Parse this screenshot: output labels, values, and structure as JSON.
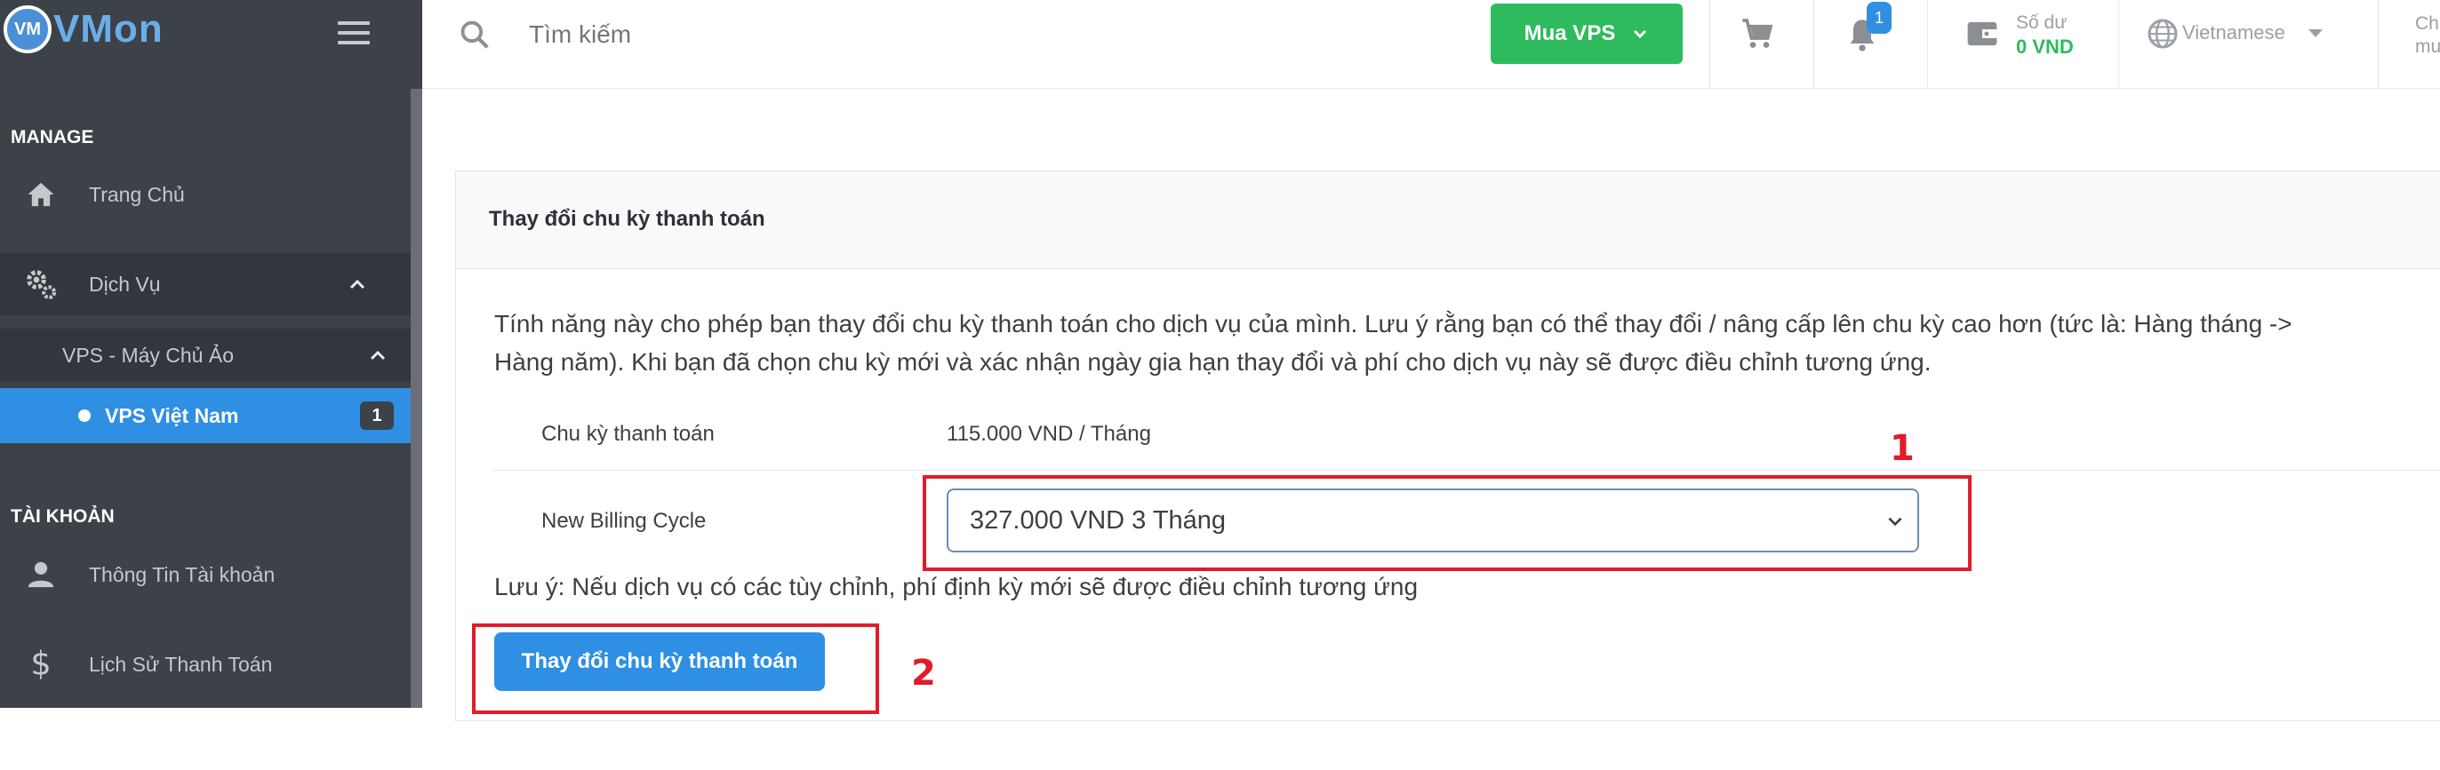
{
  "brand": {
    "logo_text": "VM",
    "name": "VMon"
  },
  "sidebar": {
    "sections": [
      {
        "label": "MANAGE"
      },
      {
        "label": "TÀI KHOẢN"
      }
    ],
    "items": {
      "home": {
        "label": "Trang Chủ",
        "icon": "home-icon"
      },
      "services": {
        "label": "Dịch Vụ",
        "icon": "gears-icon"
      },
      "vps": {
        "label": "VPS - Máy Chủ Ảo"
      },
      "vps_vn": {
        "label": "VPS Việt Nam",
        "badge": "1"
      },
      "account": {
        "label": "Thông Tin Tài khoản",
        "icon": "user-icon"
      },
      "payments": {
        "label": "Lịch Sử Thanh Toán",
        "icon": "dollar-icon"
      }
    }
  },
  "topbar": {
    "search_placeholder": "Tìm kiếm",
    "buy_label": "Mua VPS",
    "notification_count": "1",
    "balance_label": "Số dư",
    "balance_value": "0 VND",
    "language": "Vietnamese",
    "user_truncated_1": "Ch",
    "user_truncated_2": "mu"
  },
  "card": {
    "title": "Thay đổi chu kỳ thanh toán",
    "description_line1": "Tính năng này cho phép bạn thay đổi chu kỳ thanh toán cho dịch vụ của mình. Lưu ý rằng bạn có thể thay đổi / nâng cấp lên chu kỳ cao hơn (tức là: Hàng tháng ->",
    "description_line2": "Hàng năm). Khi bạn đã chọn chu kỳ mới và xác nhận ngày gia hạn thay đổi và phí cho dịch vụ này sẽ được điều chỉnh tương ứng.",
    "current_cycle_label": "Chu kỳ thanh toán",
    "current_cycle_value": "115.000 VND / Tháng",
    "new_cycle_label": "New Billing Cycle",
    "new_cycle_selected": "327.000 VND 3 Tháng",
    "note": "Lưu ý: Nếu dịch vụ có các tùy chỉnh, phí định kỳ mới sẽ được điều chỉnh tương ứng",
    "submit_label": "Thay đổi chu kỳ thanh toán"
  },
  "annotations": {
    "one": "1",
    "two": "2"
  },
  "colors": {
    "sidebar_bg": "#3d4148",
    "accent_blue": "#2f8fe3",
    "accent_green": "#2ebb5d",
    "annotation_red": "#e21b2a"
  }
}
